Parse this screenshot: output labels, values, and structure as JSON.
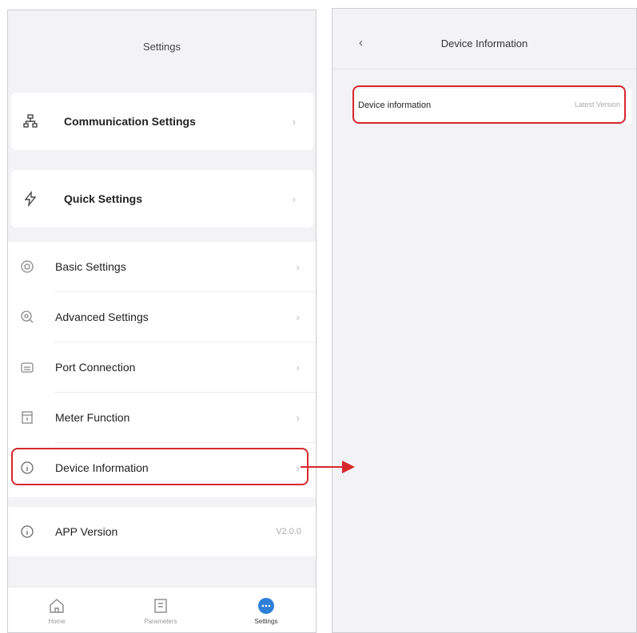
{
  "left": {
    "title": "Settings",
    "cards": {
      "communication": {
        "label": "Communication Settings",
        "icon": "network-icon"
      },
      "quick": {
        "label": "Quick Settings",
        "icon": "quick-settings-icon"
      }
    },
    "items": [
      {
        "label": "Basic Settings",
        "icon": "gear-icon"
      },
      {
        "label": "Advanced Settings",
        "icon": "advanced-gear-icon"
      },
      {
        "label": "Port Connection",
        "icon": "port-icon"
      },
      {
        "label": "Meter Function",
        "icon": "meter-icon"
      },
      {
        "label": "Device Information",
        "icon": "info-icon"
      }
    ],
    "app_version": {
      "label": "APP Version",
      "value": "V2.0.0",
      "icon": "info-icon"
    },
    "chevron": "›",
    "tabbar": [
      {
        "label": "Home",
        "icon": "home-icon"
      },
      {
        "label": "Parameters",
        "icon": "parameters-icon"
      },
      {
        "label": "Settings",
        "icon": "settings-dots-icon",
        "active": true
      }
    ]
  },
  "right": {
    "back": "‹",
    "title": "Device Information",
    "row": {
      "label": "Device information",
      "value": "Latest Version"
    }
  },
  "colors": {
    "highlight": "#d8262d",
    "accent": "#2f7fd8"
  }
}
